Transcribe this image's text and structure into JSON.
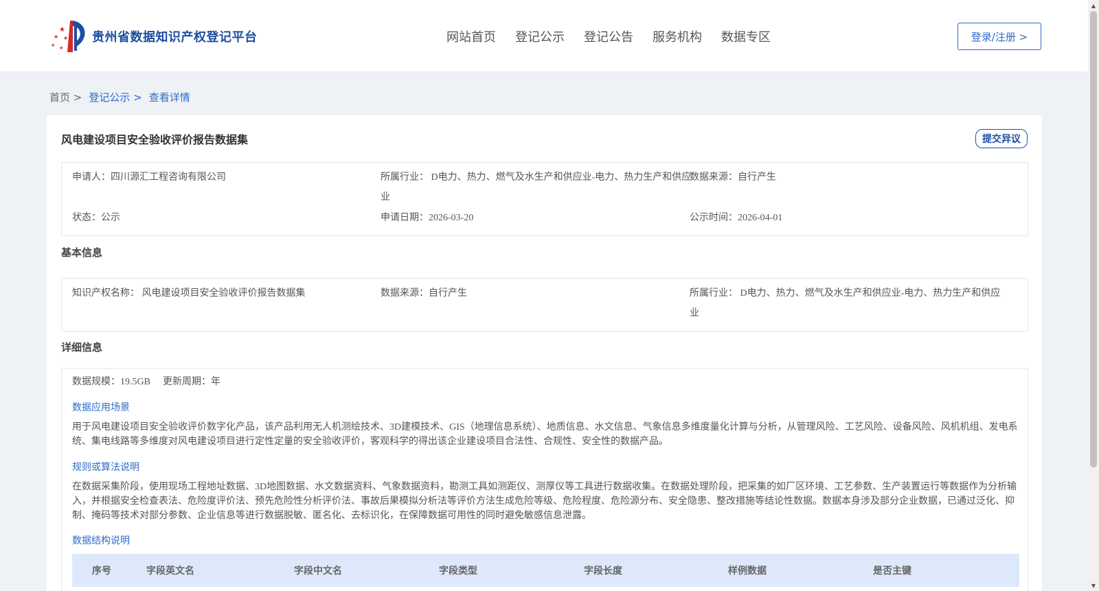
{
  "header": {
    "site_name": "贵州省数据知识产权登记平台",
    "nav": [
      "网站首页",
      "登记公示",
      "登记公告",
      "服务机构",
      "数据专区"
    ],
    "login_label": "登录/注册 >"
  },
  "breadcrumb": {
    "home": "首页 >",
    "parent": "登记公示 >",
    "current": "查看详情"
  },
  "record": {
    "title": "风电建设项目安全验收评价报告数据集",
    "objection_label": "提交异议",
    "summary": {
      "applicant": "申请人：四川源汇工程咨询有限公司",
      "industry_line1": "所属行业： D电力、热力、燃气及水生产和供应业-电力、热力生产和供应",
      "industry_line2": "业",
      "source": "数据来源：自行产生",
      "status": "状态：公示",
      "apply_date": "申请日期：2026-03-20",
      "publish_date": "公示时间：2026-04-01"
    },
    "basic_title": "基本信息",
    "basic": {
      "ip_name": "知识产权名称： 风电建设项目安全验收评价报告数据集",
      "source": "数据来源：自行产生",
      "industry_line1": "所属行业： D电力、热力、燃气及水生产和供应业-电力、热力生产和供应",
      "industry_line2": "业"
    },
    "detail_title": "详细信息",
    "detail": {
      "scale": "数据规模：19.5GB",
      "update_cycle": "更新周期：年",
      "scenario_heading": "数据应用场景",
      "scenario_text": "用于风电建设项目安全验收评价数字化产品，该产品利用无人机测绘技术、3D建模技术、GIS（地理信息系统）、地质信息、水文信息、气象信息多维度量化计算与分析，从管理风险、工艺风险、设备风险、风机机组、发电系统、集电线路等多维度对风电建设项目进行定性定量的安全验收评价，客观科学的得出该企业建设项目合法性、合规性、安全性的数据产品。",
      "rules_heading": "规则或算法说明",
      "rules_text": "在数据采集阶段，使用现场工程地址数据、3D地图数据、水文数据资料、气象数据资料，勘测工具如测距仪、测厚仪等工具进行数据收集。在数据处理阶段，把采集的如厂区环境、工艺参数、生产装置运行等数据作为分析输入，并根据安全检查表法、危险度评价法、预先危险性分析评价法、事故后果模拟分析法等评价方法生成危险等级、危险程度、危险源分布、安全隐患、整改措施等结论性数据。数据本身涉及部分企业数据，已通过泛化、抑制、掩码等技术对部分参数、企业信息等进行数据脱敏、匿名化、去标识化，在保障数据可用性的同时避免敏感信息泄露。",
      "structure_heading": "数据结构说明",
      "table_headers": [
        "序号",
        "字段英文名",
        "字段中文名",
        "字段类型",
        "字段长度",
        "样例数据",
        "是否主键"
      ]
    }
  },
  "colors": {
    "brand_blue": "#1d4ea1",
    "link_blue": "#2d6bc8",
    "table_head_bg": "#dde9fb",
    "page_bg": "#eef1f5"
  }
}
